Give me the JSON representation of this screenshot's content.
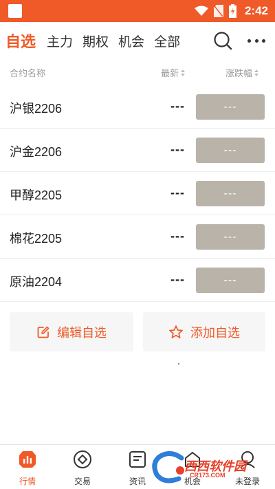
{
  "status_bar": {
    "time": "2:42"
  },
  "top_nav": {
    "tabs": [
      {
        "label": "自选",
        "active": true
      },
      {
        "label": "主力",
        "active": false
      },
      {
        "label": "期权",
        "active": false
      },
      {
        "label": "机会",
        "active": false
      },
      {
        "label": "全部",
        "active": false
      }
    ]
  },
  "table": {
    "headers": {
      "name": "合约名称",
      "latest": "最新",
      "change": "涨跌幅"
    },
    "rows": [
      {
        "name": "沪银2206",
        "latest": "---",
        "change": "---"
      },
      {
        "name": "沪金2206",
        "latest": "---",
        "change": "---"
      },
      {
        "name": "甲醇2205",
        "latest": "---",
        "change": "---"
      },
      {
        "name": "棉花2205",
        "latest": "---",
        "change": "---"
      },
      {
        "name": "原油2204",
        "latest": "---",
        "change": "---"
      }
    ]
  },
  "actions": {
    "edit_label": "编辑自选",
    "add_label": "添加自选"
  },
  "bottom_tabs": [
    {
      "label": "行情",
      "icon": "chart-icon",
      "active": true
    },
    {
      "label": "交易",
      "icon": "coin-icon",
      "active": false
    },
    {
      "label": "资讯",
      "icon": "news-icon",
      "active": false
    },
    {
      "label": "机会",
      "icon": "home-icon",
      "active": false
    },
    {
      "label": "未登录",
      "icon": "user-icon",
      "active": false
    }
  ],
  "watermark": {
    "text": "西西软件园",
    "url": "CR173.COM"
  },
  "colors": {
    "accent": "#ef5a28",
    "status_bar": "#ef5a28",
    "change_button": "#b9b3aa"
  }
}
